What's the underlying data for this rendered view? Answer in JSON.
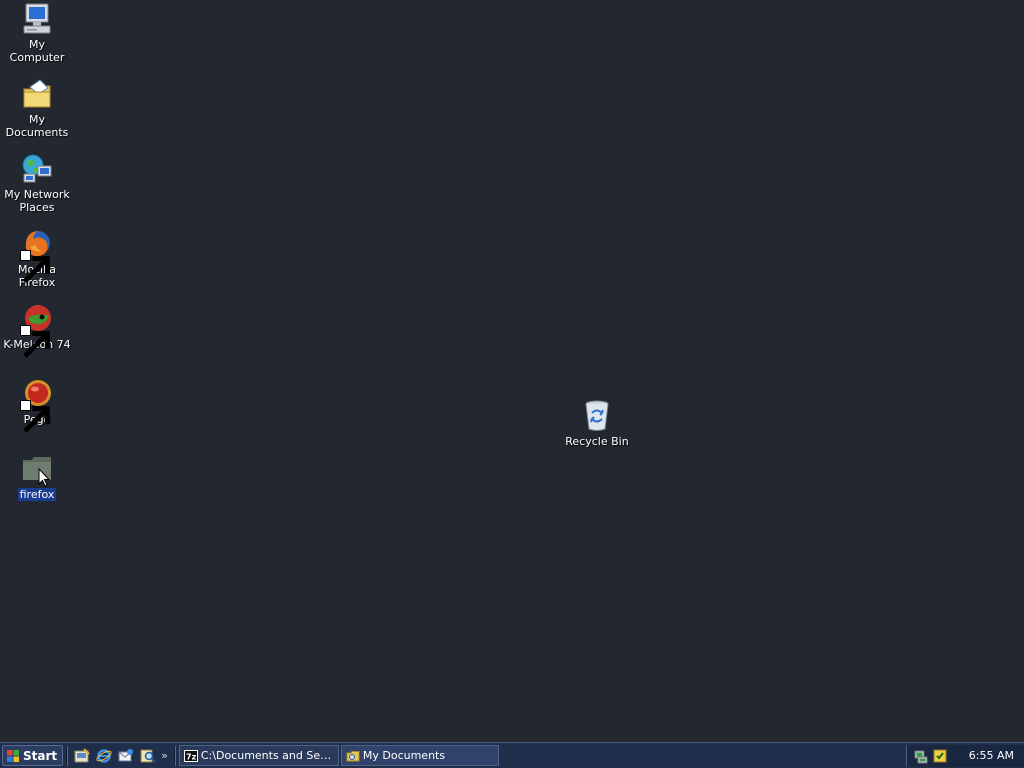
{
  "desktop": {
    "icons": [
      {
        "label": "My Computer",
        "icon": "computer-icon"
      },
      {
        "label": "My Documents",
        "icon": "documents-folder-icon"
      },
      {
        "label": "My Network Places",
        "icon": "network-places-icon"
      },
      {
        "label": "Mozilla Firefox",
        "icon": "firefox-icon",
        "shortcut": true
      },
      {
        "label": "K-Meleon 74",
        "icon": "k-meleon-icon",
        "shortcut": true
      },
      {
        "label": "Pego",
        "icon": "pego-icon",
        "shortcut": true
      },
      {
        "label": "firefox",
        "icon": "folder-icon",
        "selected": true
      },
      {
        "label": "Recycle Bin",
        "icon": "recycle-bin-icon"
      }
    ],
    "background_color": "#232830",
    "selection_color": "#1a3c8e"
  },
  "taskbar": {
    "start_label": "Start",
    "quick_launch": [
      {
        "icon": "show-desktop-icon"
      },
      {
        "icon": "internet-explorer-icon"
      },
      {
        "icon": "outlook-express-icon"
      },
      {
        "icon": "search-icon"
      }
    ],
    "more_label": "»",
    "tasks": [
      {
        "label": "C:\\Documents and Settin...",
        "icon": "7zip-icon"
      },
      {
        "label": "My Documents",
        "icon": "folder-icon",
        "active": true
      }
    ],
    "tray": {
      "icons": [
        {
          "icon": "network-tray-icon"
        },
        {
          "icon": "security-tray-icon"
        }
      ],
      "clock": "6:55 AM"
    }
  }
}
